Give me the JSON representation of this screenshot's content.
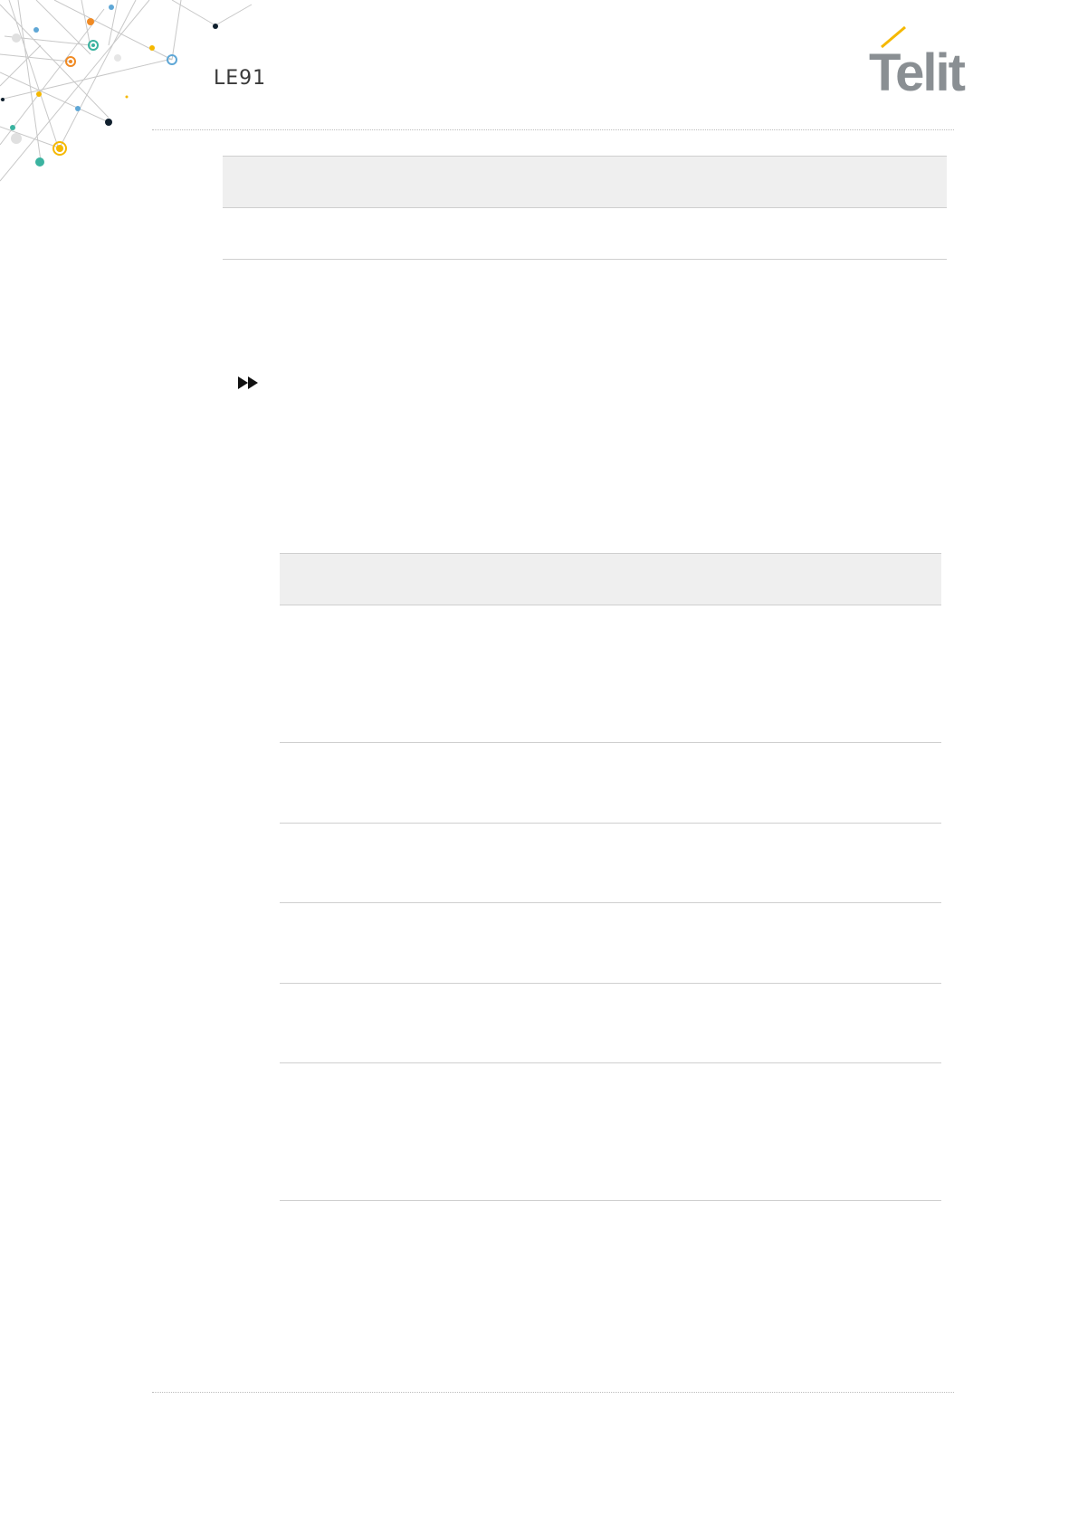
{
  "header": {
    "title": "LE91",
    "logo_text": "Telit",
    "logo_mark": "telit-logo"
  },
  "colors": {
    "accent_orange": "#f08a24",
    "accent_teal": "#3bb3a0",
    "accent_blue": "#5fa7d6",
    "accent_yellow": "#f5b800",
    "logo_gray": "#8a8f93",
    "table_band": "#efefef",
    "rule": "#cfcfcf"
  },
  "top_table": {
    "header_text": "",
    "row_text": ""
  },
  "marker": {
    "icon": "fast-forward-icon"
  },
  "param_table": {
    "header_text": "",
    "rows": [
      "",
      "",
      "",
      "",
      "",
      ""
    ]
  }
}
